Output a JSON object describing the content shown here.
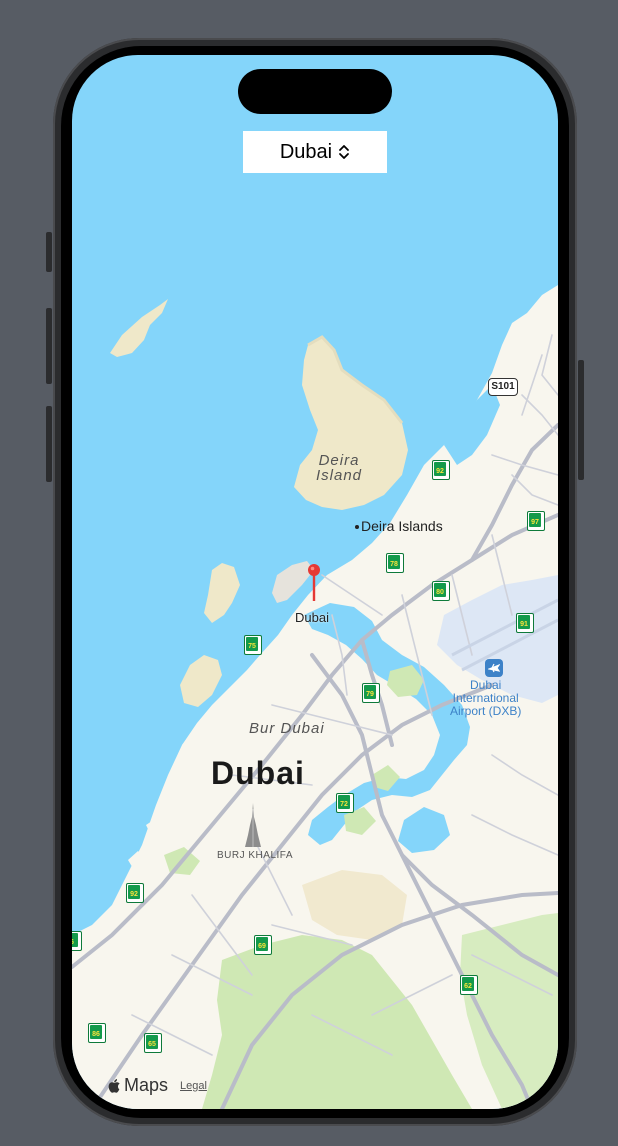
{
  "picker": {
    "label": "Dubai"
  },
  "map": {
    "city_label": "Dubai",
    "district_label": "Bur Dubai",
    "island_label_line1": "Deira",
    "island_label_line2": "Island",
    "poi_deira_islands": "Deira Islands",
    "pin_label": "Dubai",
    "airport_line1": "Dubai",
    "airport_line2": "International",
    "airport_line3": "Airport (DXB)",
    "landmark_label": "BURJ KHALIFA",
    "road_shield_s101": "S101",
    "route_shields": [
      "92",
      "97",
      "78",
      "80",
      "91",
      "75",
      "79",
      "72",
      "92",
      "69",
      "62",
      "86",
      "65",
      "6"
    ]
  },
  "attribution": {
    "brand": "Maps",
    "legal": "Legal"
  },
  "colors": {
    "water": "#84d5fa",
    "land": "#f8f6ee",
    "park": "#cfe8b4",
    "road": "#b9bcc8",
    "pin": "#e53935",
    "airport": "#3d82c8",
    "shield": "#149a4b"
  }
}
